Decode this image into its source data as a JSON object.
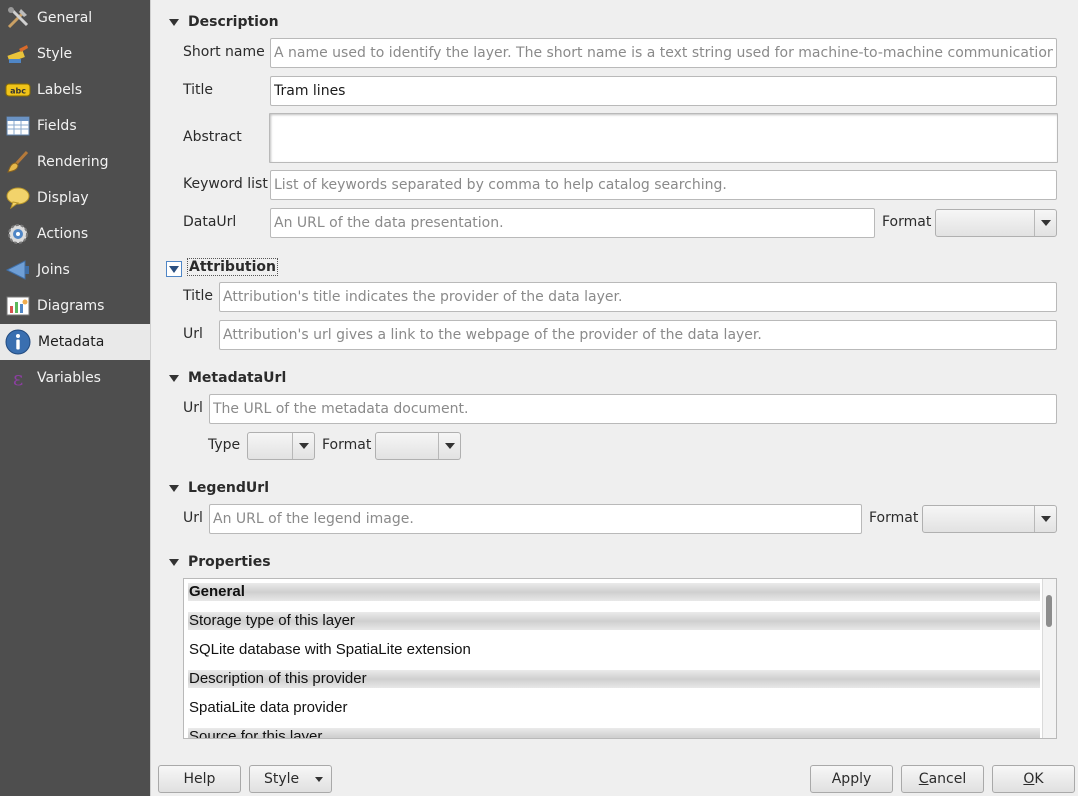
{
  "sidebar": {
    "items": [
      {
        "label": "General",
        "icon": "tools-icon"
      },
      {
        "label": "Style",
        "icon": "paintbrush-icon"
      },
      {
        "label": "Labels",
        "icon": "abc-label-icon"
      },
      {
        "label": "Fields",
        "icon": "table-icon"
      },
      {
        "label": "Rendering",
        "icon": "brush-icon"
      },
      {
        "label": "Display",
        "icon": "speech-bubble-icon"
      },
      {
        "label": "Actions",
        "icon": "gear-icon"
      },
      {
        "label": "Joins",
        "icon": "joins-icon"
      },
      {
        "label": "Diagrams",
        "icon": "diagram-icon"
      },
      {
        "label": "Metadata",
        "icon": "info-icon",
        "selected": true
      },
      {
        "label": "Variables",
        "icon": "epsilon-icon"
      }
    ]
  },
  "description": {
    "title": "Description",
    "short_name_label": "Short name",
    "short_name_placeholder": "A name used to identify the layer. The short name is a text string used for machine-to-machine communication.",
    "title_label": "Title",
    "title_value": "Tram lines",
    "abstract_label": "Abstract",
    "keyword_label": "Keyword list",
    "keyword_placeholder": "List of keywords separated by comma to help catalog searching.",
    "dataurl_label": "DataUrl",
    "dataurl_placeholder": "An URL of the data presentation.",
    "format_label": "Format"
  },
  "attribution": {
    "title": "Attribution",
    "title_label": "Title",
    "title_placeholder": "Attribution's title indicates the provider of the data layer.",
    "url_label": "Url",
    "url_placeholder": "Attribution's url gives a link to the webpage of the provider of the data layer."
  },
  "metadataurl": {
    "title": "MetadataUrl",
    "url_label": "Url",
    "url_placeholder": "The URL of the metadata document.",
    "type_label": "Type",
    "format_label": "Format"
  },
  "legendurl": {
    "title": "LegendUrl",
    "url_label": "Url",
    "url_placeholder": "An URL of the legend image.",
    "format_label": "Format"
  },
  "properties": {
    "title": "Properties",
    "rows": [
      {
        "text": "General",
        "type": "header-bold"
      },
      {
        "text": "Storage type of this layer",
        "type": "header"
      },
      {
        "text": "SQLite database with SpatiaLite extension",
        "type": "value"
      },
      {
        "text": "Description of this provider",
        "type": "header"
      },
      {
        "text": "SpatiaLite data provider",
        "type": "value"
      },
      {
        "text": "Source for this layer",
        "type": "header"
      }
    ]
  },
  "buttons": {
    "help": "Help",
    "style": "Style",
    "apply": "Apply",
    "cancel_first": "C",
    "cancel_rest": "ancel",
    "ok_first": "O",
    "ok_rest": "K"
  }
}
